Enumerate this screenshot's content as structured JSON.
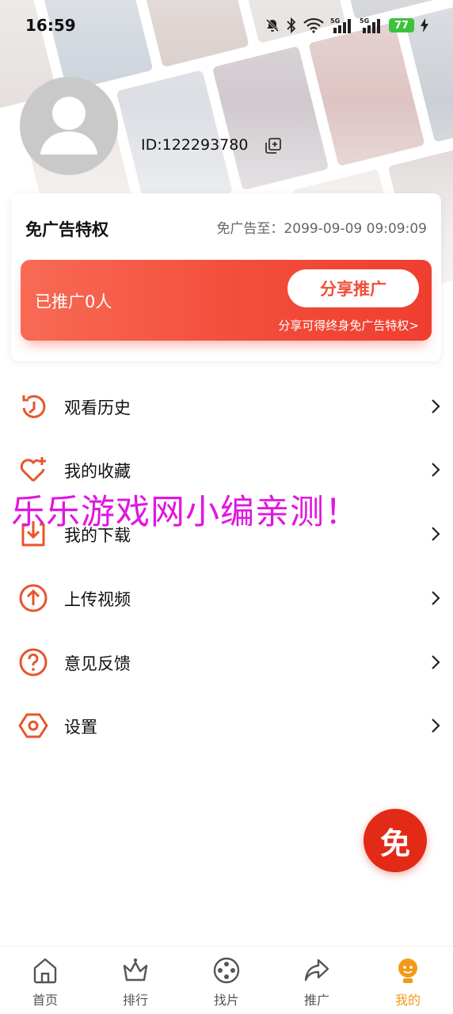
{
  "status_bar": {
    "time": "16:59",
    "icons": [
      "mute-bell-icon",
      "bluetooth-icon",
      "wifi-icon",
      "signal-5g-icon",
      "signal-5g-icon",
      "battery-icon",
      "charging-icon"
    ],
    "battery_level": "77"
  },
  "profile": {
    "avatar_icon": "avatar-placeholder-icon",
    "user_id": "ID:122293780",
    "copy_icon": "copy-icon"
  },
  "privilege_card": {
    "title": "免广告特权",
    "expiry": "免广告至：2099-09-09 09:09:09",
    "promo": {
      "count_text": "已推广0人",
      "share_button": "分享推广",
      "note": "分享可得终身免广告特权>"
    }
  },
  "menu": {
    "items": [
      {
        "label": "观看历史",
        "icon": "history-icon"
      },
      {
        "label": "我的收藏",
        "icon": "heart-plus-icon"
      },
      {
        "label": "我的下载",
        "icon": "download-icon"
      },
      {
        "label": "上传视频",
        "icon": "upload-icon"
      },
      {
        "label": "意见反馈",
        "icon": "question-icon"
      },
      {
        "label": "设置",
        "icon": "settings-icon"
      }
    ]
  },
  "watermark": "乐乐游戏网小编亲测！",
  "fab_label": "免",
  "bottom_nav": {
    "items": [
      {
        "label": "首页",
        "icon": "home-icon",
        "active": false
      },
      {
        "label": "排行",
        "icon": "crown-icon",
        "active": false
      },
      {
        "label": "找片",
        "icon": "film-reel-icon",
        "active": false
      },
      {
        "label": "推广",
        "icon": "share-arrow-icon",
        "active": false
      },
      {
        "label": "我的",
        "icon": "user-icon",
        "active": true
      }
    ]
  },
  "colors": {
    "accent": "#f24d3b",
    "icon_orange": "#e8552d",
    "active_nav": "#f29a18",
    "fab": "#e22a17",
    "watermark": "#e016e0"
  }
}
